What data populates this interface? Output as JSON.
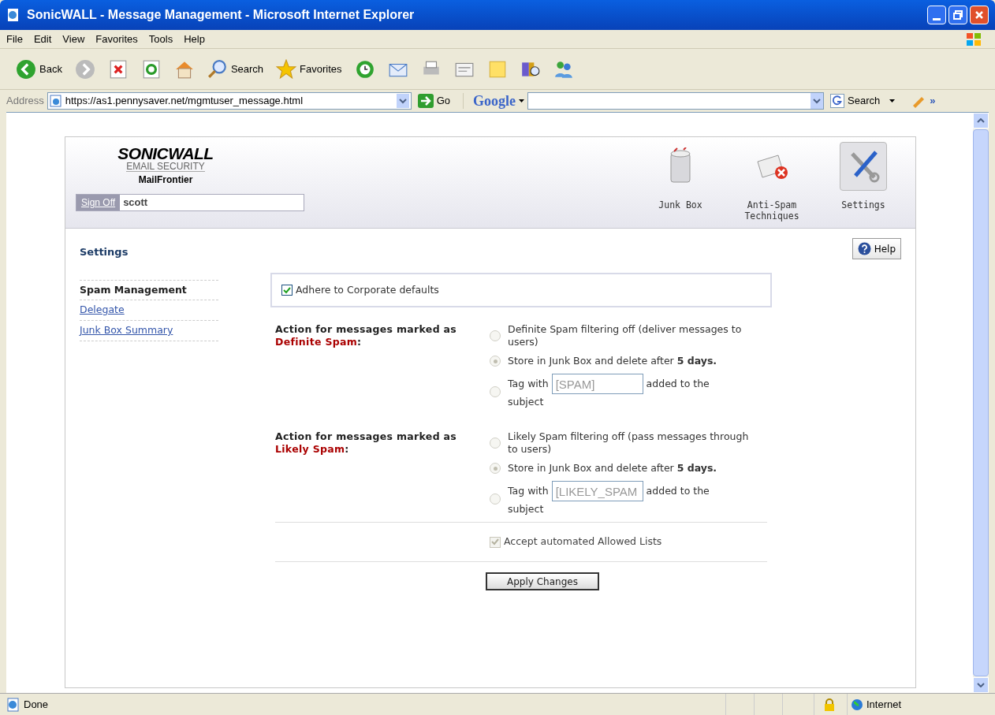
{
  "window": {
    "title": "SonicWALL - Message Management - Microsoft Internet Explorer"
  },
  "menu": [
    "File",
    "Edit",
    "View",
    "Favorites",
    "Tools",
    "Help"
  ],
  "toolbar": [
    {
      "kind": "back",
      "label": "Back"
    },
    {
      "kind": "forward"
    },
    {
      "kind": "stop"
    },
    {
      "kind": "refresh"
    },
    {
      "kind": "home"
    },
    {
      "kind": "search",
      "label": "Search"
    },
    {
      "kind": "favorites",
      "label": "Favorites"
    },
    {
      "kind": "history"
    },
    {
      "kind": "mail"
    },
    {
      "kind": "print"
    },
    {
      "kind": "edit"
    },
    {
      "kind": "note"
    },
    {
      "kind": "research"
    },
    {
      "kind": "messenger"
    }
  ],
  "address_bar": {
    "label": "Address",
    "url": "https://as1.pennysaver.net/mgmtuser_message.html",
    "go": "Go",
    "google": "Google",
    "search": "Search",
    "more": "»"
  },
  "app_header": {
    "logo": {
      "brand": "SONICWALL",
      "subtitle": "EMAIL SECURITY",
      "product": "MailFrontier"
    },
    "sign_off": "Sign Off",
    "user": "scott",
    "nav": [
      {
        "kind": "junk",
        "label": "Junk Box",
        "selected": false
      },
      {
        "kind": "antispam",
        "label": "Anti-Spam Techniques",
        "selected": false
      },
      {
        "kind": "settings",
        "label": "Settings",
        "selected": true
      }
    ]
  },
  "page": {
    "heading": "Settings",
    "help": "Help"
  },
  "sidebar": {
    "items": [
      {
        "label": "Spam Management",
        "selected": true
      },
      {
        "label": "Delegate",
        "selected": false
      },
      {
        "label": "Junk Box Summary",
        "selected": false
      }
    ]
  },
  "corporate_defaults": {
    "label": "Adhere to Corporate defaults",
    "checked": true
  },
  "sections": [
    {
      "label": "Action for messages marked as",
      "highlight": "Definite Spam",
      "suffix": ":",
      "options": [
        {
          "kind": "text",
          "label": "Definite Spam filtering off (deliver messages to users)",
          "selected": false,
          "disabled": true
        },
        {
          "kind": "text",
          "label": "Store in Junk Box and delete after **5 days.**",
          "selected": true,
          "disabled": true
        },
        {
          "kind": "tag",
          "label": "Tag with",
          "value": "[SPAM]",
          "after": "added to the subject",
          "selected": false,
          "disabled": true
        }
      ]
    },
    {
      "label": "Action for messages marked as",
      "highlight": "Likely Spam",
      "suffix": ":",
      "options": [
        {
          "kind": "text",
          "label": "Likely Spam filtering off (pass messages through to users)",
          "selected": false,
          "disabled": true
        },
        {
          "kind": "text",
          "label": "Store in Junk Box and delete after **5 days.**",
          "selected": true,
          "disabled": true
        },
        {
          "kind": "tag",
          "label": "Tag with",
          "value": "[LIKELY_SPAM",
          "after": "added to the subject",
          "selected": false,
          "disabled": true
        }
      ]
    }
  ],
  "allowed_lists": {
    "label": "Accept automated Allowed Lists",
    "checked": true,
    "disabled": true
  },
  "apply": "Apply Changes",
  "status_bar": {
    "text": "Done",
    "zone": "Internet"
  }
}
